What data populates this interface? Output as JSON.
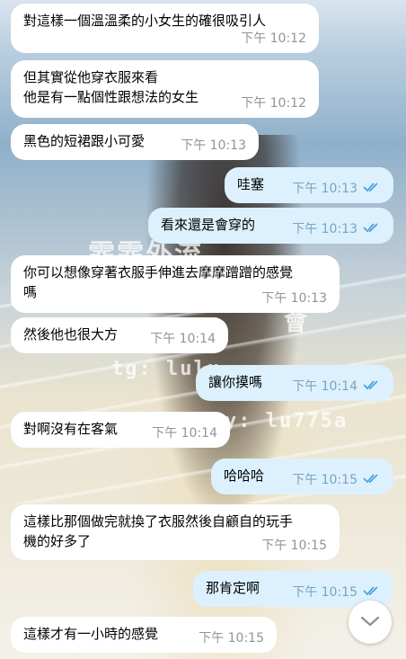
{
  "background": {
    "watermark_top": "霏霏外流",
    "watermark_tg": "tg: lulu",
    "watermark_y": "y: lu775a",
    "watermark_mid": "會"
  },
  "messages": [
    {
      "text": "對這樣一個溫溫柔的小女生的確很吸引人",
      "time": "下午 10:12"
    },
    {
      "text": "但其實從他穿衣服來看\n他是有一點個性跟想法的女生",
      "time": "下午 10:12"
    },
    {
      "text": "黑色的短裙跟小可愛",
      "time": "下午 10:13"
    },
    {
      "text": "哇塞",
      "time": "下午 10:13"
    },
    {
      "text": "看來還是會穿的",
      "time": "下午 10:13"
    },
    {
      "text": "你可以想像穿著衣服手伸進去摩摩蹭蹭的感覺\n嗎",
      "time": "下午 10:13"
    },
    {
      "text": "然後他也很大方",
      "time": "下午 10:14"
    },
    {
      "text": "讓你摸嗎",
      "time": "下午 10:14"
    },
    {
      "text": "對啊沒有在客氣",
      "time": "下午 10:14"
    },
    {
      "text": "哈哈哈",
      "time": "下午 10:15"
    },
    {
      "text": "這樣比那個做完就換了衣服然後自顧自的玩手\n機的好多了",
      "time": "下午 10:15"
    },
    {
      "text": "那肯定啊",
      "time": "下午 10:15"
    },
    {
      "text": "這樣才有一小時的感覺",
      "time": "下午 10:15"
    }
  ],
  "colors": {
    "incoming": "#ffffff",
    "outgoing": "#dcf1fd",
    "check": "#4fa3e0"
  },
  "icons": {
    "read_receipt": "double-check-icon",
    "scroll_down": "chevron-down-icon"
  }
}
